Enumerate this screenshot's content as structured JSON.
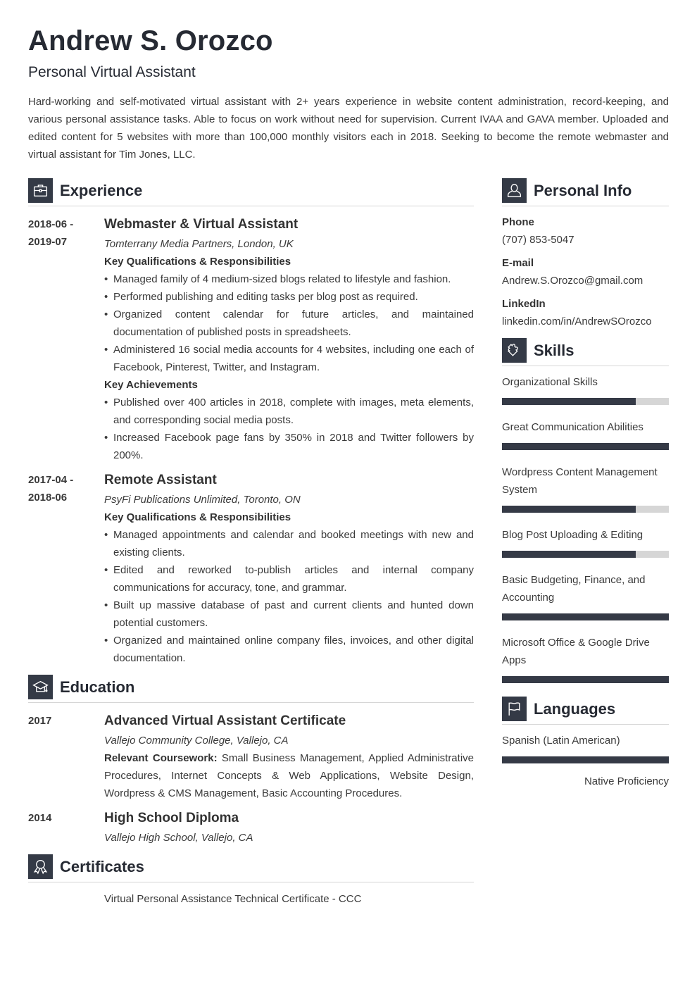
{
  "header": {
    "name": "Andrew S. Orozco",
    "title": "Personal Virtual Assistant",
    "summary": "Hard-working and self-motivated virtual assistant with 2+ years experience in website content administration, record-keeping, and various personal assistance tasks. Able to focus on work without need for supervision. Current IVAA and GAVA member. Uploaded and edited content for 5 websites with more than 100,000 monthly visitors each in 2018. Seeking to become the remote webmaster and virtual assistant for Tim Jones, LLC."
  },
  "experience": {
    "heading": "Experience",
    "icon": "briefcase-icon",
    "jobs": [
      {
        "date_start": "2018-06 -",
        "date_end": "2019-07",
        "role": "Webmaster & Virtual Assistant",
        "company": "Tomterrany Media Partners, London, UK",
        "resp_heading": "Key Qualifications & Responsibilities",
        "responsibilities": [
          "Managed family of 4 medium-sized blogs related to lifestyle and fashion.",
          "Performed publishing and editing tasks per blog post as required.",
          "Organized content calendar for future articles, and maintained documentation of published posts in spreadsheets.",
          "Administered 16 social media accounts for 4 websites, including one each of Facebook, Pinterest, Twitter, and Instagram."
        ],
        "ach_heading": "Key Achievements",
        "achievements": [
          "Published over 400 articles in 2018, complete with images, meta elements, and corresponding social media posts.",
          "Increased Facebook page fans by 350% in 2018 and Twitter followers by 200%."
        ]
      },
      {
        "date_start": "2017-04 -",
        "date_end": "2018-06",
        "role": "Remote Assistant",
        "company": "PsyFi Publications Unlimited, Toronto, ON",
        "resp_heading": "Key Qualifications & Responsibilities",
        "responsibilities": [
          "Managed appointments and calendar and booked meetings with new and existing clients.",
          "Edited and reworked to-publish articles and internal company communications for accuracy, tone, and grammar.",
          "Built up massive database of past and current clients and hunted down potential customers.",
          "Organized and maintained online company files, invoices, and other digital documentation."
        ]
      }
    ]
  },
  "education": {
    "heading": "Education",
    "icon": "graduation-cap-icon",
    "items": [
      {
        "year": "2017",
        "degree": "Advanced Virtual Assistant Certificate",
        "school": "Vallejo Community College, Vallejo, CA",
        "coursework_label": "Relevant Coursework:",
        "coursework": "Small Business Management, Applied Administrative Procedures, Internet Concepts & Web Applications, Website Design, Wordpress & CMS Management, Basic Accounting Procedures."
      },
      {
        "year": "2014",
        "degree": "High School Diploma",
        "school": "Vallejo High School, Vallejo, CA"
      }
    ]
  },
  "certificates": {
    "heading": "Certificates",
    "icon": "award-ribbon-icon",
    "items": [
      "Virtual Personal Assistance Technical Certificate - CCC"
    ]
  },
  "personal_info": {
    "heading": "Personal Info",
    "icon": "user-icon",
    "phone_label": "Phone",
    "phone": "(707) 853-5047",
    "email_label": "E-mail",
    "email": "Andrew.S.Orozco@gmail.com",
    "linkedin_label": "LinkedIn",
    "linkedin": "linkedin.com/in/AndrewSOrozco"
  },
  "skills": {
    "heading": "Skills",
    "icon": "puzzle-piece-icon",
    "items": [
      {
        "name": "Organizational Skills",
        "level": 0.8
      },
      {
        "name": "Great Communication Abilities",
        "level": 1.0
      },
      {
        "name": "Wordpress Content Management System",
        "level": 0.8
      },
      {
        "name": "Blog Post Uploading & Editing",
        "level": 0.8
      },
      {
        "name": "Basic Budgeting, Finance, and Accounting",
        "level": 1.0
      },
      {
        "name": "Microsoft Office & Google Drive Apps",
        "level": 1.0
      }
    ]
  },
  "languages": {
    "heading": "Languages",
    "icon": "flag-icon",
    "items": [
      {
        "name": "Spanish (Latin American)",
        "level": 1.0,
        "level_label": "Native Proficiency"
      }
    ]
  },
  "colors": {
    "accent_dark": "#343a46",
    "bar_track": "#d6d6d6",
    "text": "#3a3a3a"
  }
}
